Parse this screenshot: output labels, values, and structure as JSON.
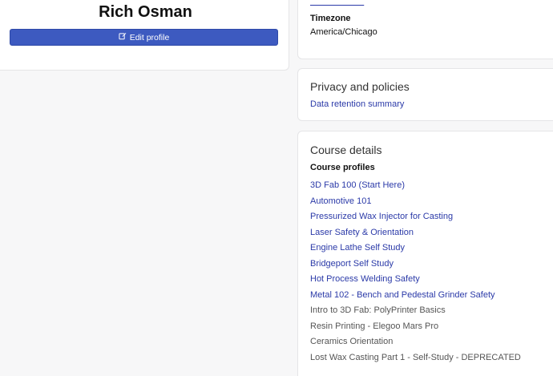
{
  "profile": {
    "name": "Rich Osman",
    "edit_label": "Edit profile"
  },
  "user_details": {
    "email_partial": "",
    "timezone_label": "Timezone",
    "timezone_value": "America/Chicago"
  },
  "privacy": {
    "title": "Privacy and policies",
    "link": "Data retention summary"
  },
  "course_details": {
    "title": "Course details",
    "profiles_label": "Course profiles",
    "courses": [
      {
        "name": "3D Fab 100 (Start Here)",
        "link": true
      },
      {
        "name": "Automotive 101",
        "link": true
      },
      {
        "name": "Pressurized Wax Injector for Casting",
        "link": true
      },
      {
        "name": "Laser Safety & Orientation",
        "link": true
      },
      {
        "name": "Engine Lathe Self Study",
        "link": true
      },
      {
        "name": "Bridgeport Self Study",
        "link": true
      },
      {
        "name": "Hot Process Welding Safety",
        "link": true
      },
      {
        "name": "Metal 102 - Bench and Pedestal Grinder Safety",
        "link": true
      },
      {
        "name": "Intro to 3D Fab: PolyPrinter Basics",
        "link": false
      },
      {
        "name": "Resin Printing - Elegoo Mars Pro",
        "link": false
      },
      {
        "name": "Ceramics Orientation",
        "link": false
      },
      {
        "name": "Lost Wax Casting Part 1 - Self-Study - DEPRECATED",
        "link": false
      }
    ]
  },
  "colors": {
    "accent": "#3d5ac0",
    "link": "#2b3aa8",
    "muted": "#555555"
  }
}
